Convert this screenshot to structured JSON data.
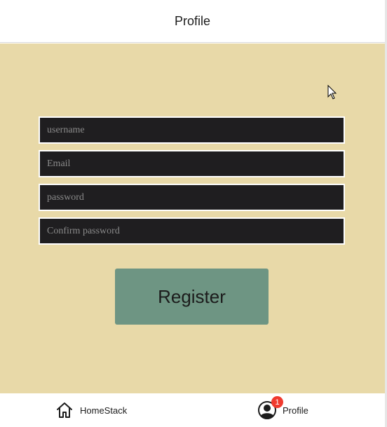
{
  "header": {
    "title": "Profile"
  },
  "form": {
    "username_placeholder": "username",
    "email_placeholder": "Email",
    "password_placeholder": "password",
    "confirm_password_placeholder": "Confirm password",
    "register_label": "Register"
  },
  "tabbar": {
    "home": {
      "label": "HomeStack",
      "icon": "home-icon"
    },
    "profile": {
      "label": "Profile",
      "icon": "user-circle-icon",
      "badge": "1"
    }
  },
  "colors": {
    "background": "#e8d9a8",
    "input_background": "#1f1e20",
    "button": "#6e9583",
    "badge": "#f03a2e"
  }
}
